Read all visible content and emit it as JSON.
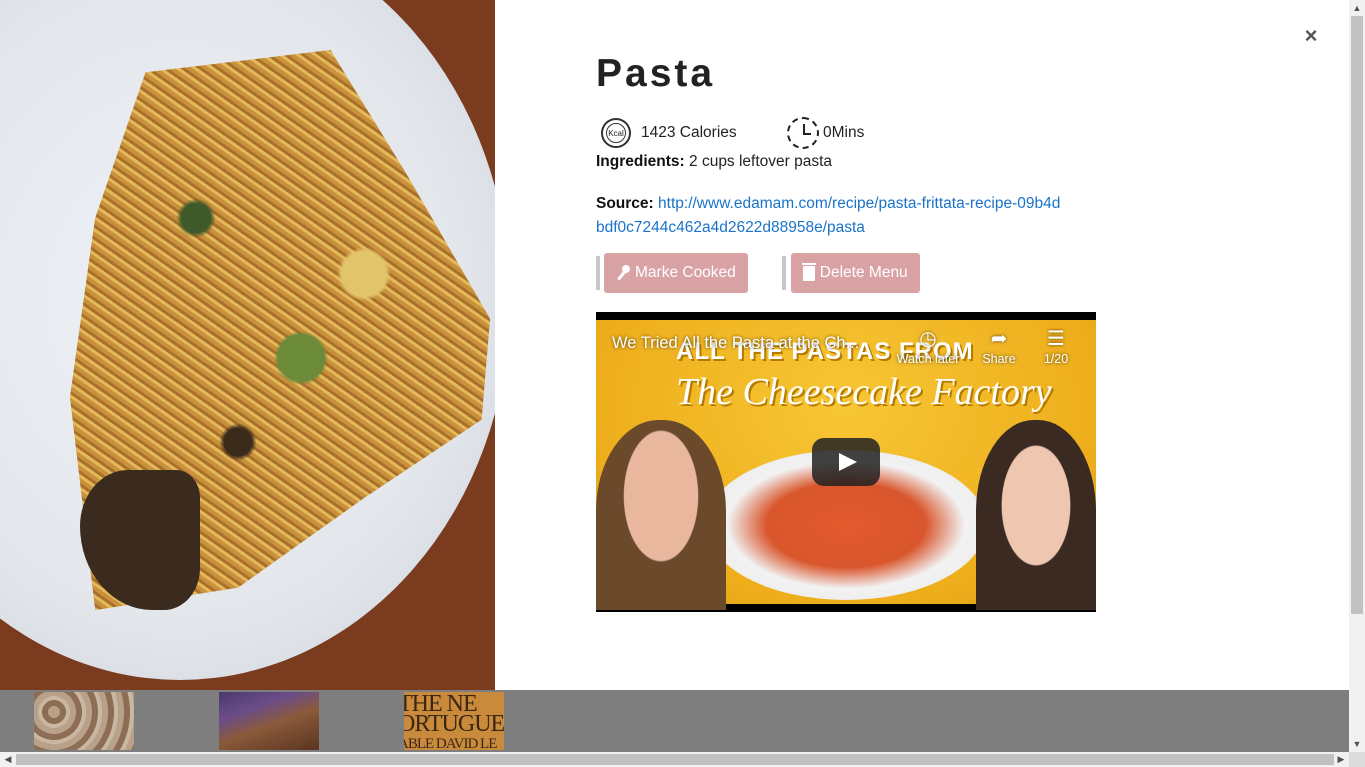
{
  "recipe": {
    "title": "Pasta",
    "calories": "1423 Calories",
    "calories_icon_text": "Kcal",
    "time": "0Mins",
    "ingredients_label": "Ingredients:",
    "ingredients": "2 cups leftover pasta",
    "source_label": "Source:",
    "source_url": "http://www.edamam.com/recipe/pasta-frittata-recipe-09b4dbdf0c7244c462a4d2622d88958e/pasta"
  },
  "modal": {
    "close_label": "×"
  },
  "actions": {
    "cooked_label": "Marke Cooked",
    "delete_label": "Delete Menu"
  },
  "video": {
    "title": "We Tried All the Pasta at the Ch...",
    "banner": "ALL THE PASTAS FROM",
    "brand": "The Cheesecake Factory",
    "watch_later": "Watch later",
    "share": "Share",
    "playlist": "1/20"
  },
  "background": {
    "thumb3_lines": [
      "THE NE",
      "ORTUGUES",
      "ABLE DAVID LE"
    ]
  },
  "colors": {
    "button_bg": "#d9a2a5",
    "link": "#1a73c8",
    "overlay": "#8f8f8f"
  }
}
